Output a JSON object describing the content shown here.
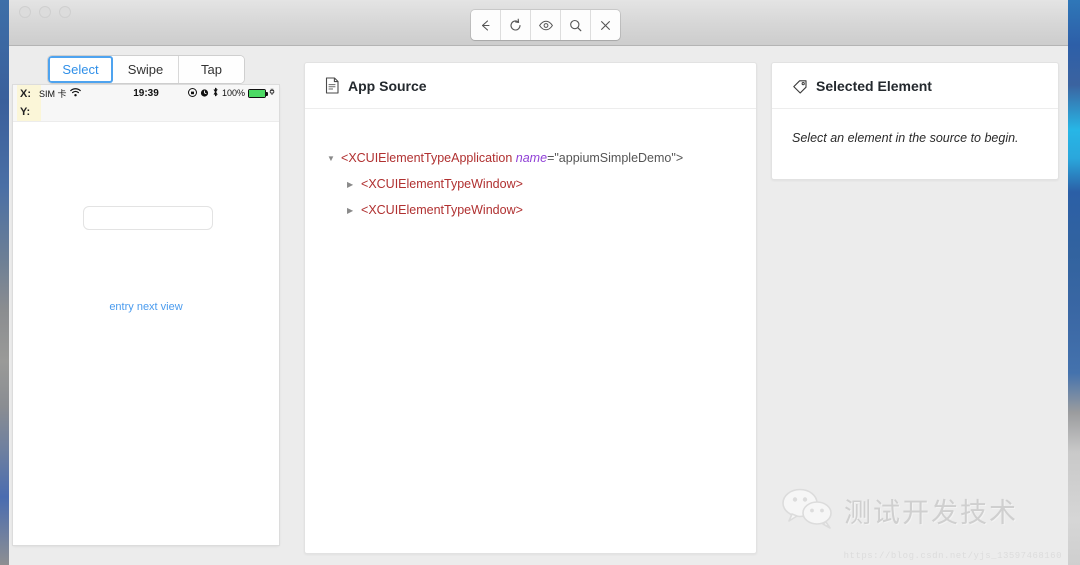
{
  "window": {
    "traffic_lights": [
      "close",
      "minimize",
      "zoom"
    ]
  },
  "toolbar": {
    "buttons": [
      {
        "name": "back",
        "icon": "arrow-left-icon",
        "glyph": "←"
      },
      {
        "name": "refresh",
        "icon": "refresh-icon",
        "glyph": "↻"
      },
      {
        "name": "inspect",
        "icon": "eye-icon",
        "glyph": "◉"
      },
      {
        "name": "search",
        "icon": "search-icon",
        "glyph": "⚲"
      },
      {
        "name": "close",
        "icon": "close-icon",
        "glyph": "✕"
      }
    ]
  },
  "device_panel": {
    "tabs": [
      {
        "label": "Select",
        "active": true
      },
      {
        "label": "Swipe",
        "active": false
      },
      {
        "label": "Tap",
        "active": false
      }
    ],
    "coordinates": {
      "x_label": "X:",
      "y_label": "Y:",
      "x_value": "",
      "y_value": "",
      "highlight_color": "#fbf6d8"
    },
    "status_bar": {
      "carrier": "SIM 卡",
      "wifi_icon": "wifi-icon",
      "time": "19:39",
      "rotation_lock_icon": "rotation-lock-icon",
      "alarm_icon": "alarm-icon",
      "bluetooth_icon": "bluetooth-icon",
      "battery_percent": "100%",
      "battery_color": "#4cd964",
      "charging_icon": "charging-plug-icon"
    },
    "screen": {
      "text_field_value": "",
      "text_field_placeholder": "",
      "link_label": "entry next view",
      "link_color": "#4a9bee"
    }
  },
  "source_panel": {
    "icon": "document-icon",
    "title": "App Source",
    "tree": [
      {
        "level": 1,
        "expanded": true,
        "prefix": "<",
        "tag": "XCUIElementTypeApplication",
        "attr_name": "name",
        "attr_eq": "=",
        "attr_value": "\"appiumSimpleDemo\"",
        "suffix": ">"
      },
      {
        "level": 2,
        "expanded": false,
        "prefix": "<",
        "tag": "XCUIElementTypeWindow",
        "attr_name": "",
        "attr_eq": "",
        "attr_value": "",
        "suffix": ">"
      },
      {
        "level": 2,
        "expanded": false,
        "prefix": "<",
        "tag": "XCUIElementTypeWindow",
        "attr_name": "",
        "attr_eq": "",
        "attr_value": "",
        "suffix": ">"
      }
    ]
  },
  "selected_panel": {
    "icon": "tag-icon",
    "title": "Selected Element",
    "empty_message": "Select an element in the source to begin."
  },
  "watermark": {
    "logo_icon": "wechat-icon",
    "text": "测试开发技术",
    "url": "https://blog.csdn.net/yjs_13597468160"
  },
  "colors": {
    "accent_blue": "#4ea3ef",
    "tag_red": "#b03030",
    "attr_purple": "#8f3fd6",
    "window_bg": "#ececec"
  }
}
